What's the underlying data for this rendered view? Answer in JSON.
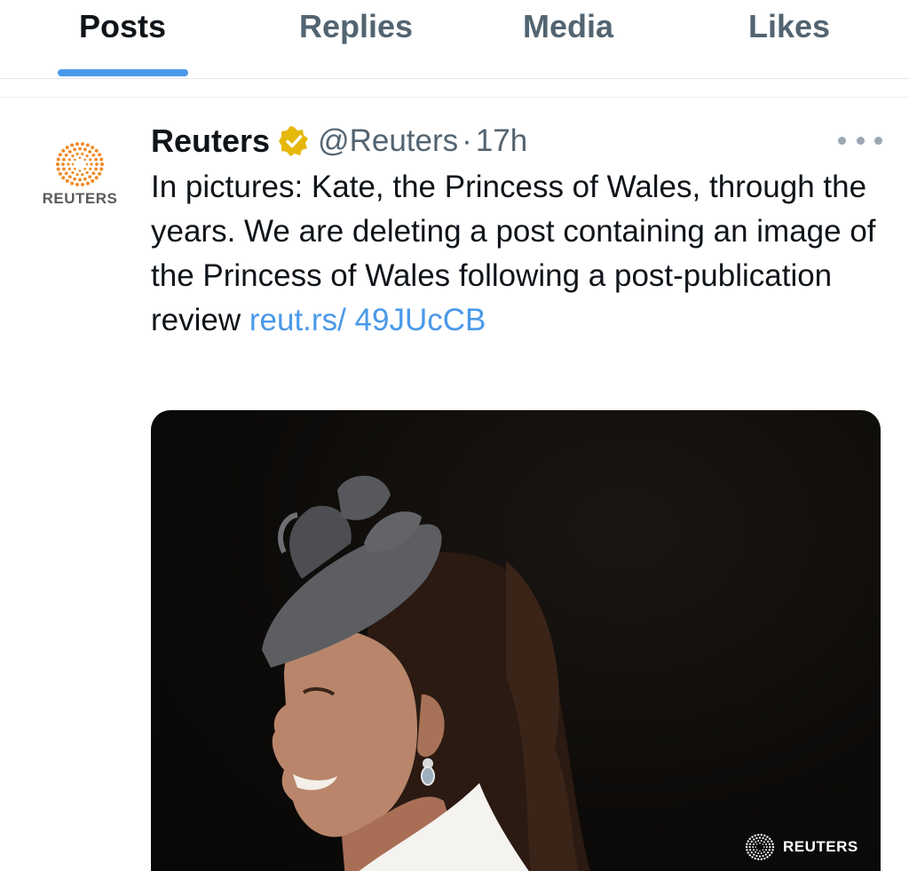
{
  "tabs": [
    {
      "label": "Posts",
      "active": true
    },
    {
      "label": "Replies",
      "active": false
    },
    {
      "label": "Media",
      "active": false
    },
    {
      "label": "Likes",
      "active": false
    }
  ],
  "post": {
    "author": "Reuters",
    "handle": "@Reuters",
    "separator": "·",
    "time": "17h",
    "avatar_label": "REUTERS",
    "verified": true,
    "verified_color": "#e5b80b",
    "text": "In pictures: Kate, the Princess of Wales, through the years. We are deleting a post containing an image of the Princess of Wales following a post-publication review ",
    "link": "reut.rs/ 49JUcCB",
    "link_color": "#4a99e9",
    "more_icon": "ellipsis-icon",
    "media": {
      "watermark": "REUTERS"
    }
  },
  "colors": {
    "accent": "#4a99e9",
    "brand_orange": "#f08a24",
    "muted_text": "#536471"
  }
}
